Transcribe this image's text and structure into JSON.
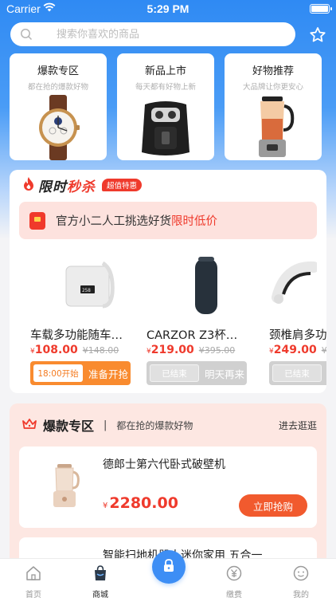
{
  "status_bar": {
    "carrier": "Carrier",
    "time": "5:29 PM"
  },
  "search": {
    "placeholder": "搜索你喜欢的商品"
  },
  "categories": [
    {
      "title": "爆款专区",
      "subtitle": "都在抢的爆款好物"
    },
    {
      "title": "新品上市",
      "subtitle": "每天都有好物上新"
    },
    {
      "title": "好物推荐",
      "subtitle": "大品牌让你更安心"
    }
  ],
  "flash_sale": {
    "title_part1": "限时",
    "title_part2": "秒杀",
    "badge": "超值特惠",
    "banner_text": "官方小二人工挑选好货",
    "banner_highlight": "限时低价",
    "products": [
      {
        "name": "车载多功能随车…",
        "currency": "¥",
        "price": "108.00",
        "old_price": "¥148.00",
        "left": "18:00开始",
        "right": "准备开抢",
        "state": "upcoming"
      },
      {
        "name": "CARZOR Z3杯…",
        "currency": "¥",
        "price": "219.00",
        "old_price": "¥395.00",
        "left": "已结束",
        "right": "明天再来",
        "state": "ended"
      },
      {
        "name": "颈椎肩多功",
        "currency": "¥",
        "price": "249.00",
        "old_price": "¥3",
        "left": "已结束",
        "right": "明",
        "state": "ended"
      }
    ]
  },
  "hot_zone": {
    "title": "爆款专区",
    "separator": "|",
    "subtitle": "都在抢的爆款好物",
    "more": "进去逛逛",
    "items": [
      {
        "name": "德郎士第六代卧式破壁机",
        "currency": "¥",
        "price": "2280.00",
        "buy": "立即抢购"
      },
      {
        "name": "智能扫地机器人迷你家用 五合一"
      }
    ]
  },
  "tabbar": [
    {
      "label": "首页",
      "icon": "home-icon"
    },
    {
      "label": "商城",
      "icon": "shopping-bag-icon"
    },
    {
      "label": "缴费",
      "icon": "yuan-coin-icon"
    },
    {
      "label": "我的",
      "icon": "smiley-icon"
    }
  ],
  "colors": {
    "primary": "#2f8af3",
    "accent": "#ef3a2c",
    "orange": "#f98b2f"
  }
}
